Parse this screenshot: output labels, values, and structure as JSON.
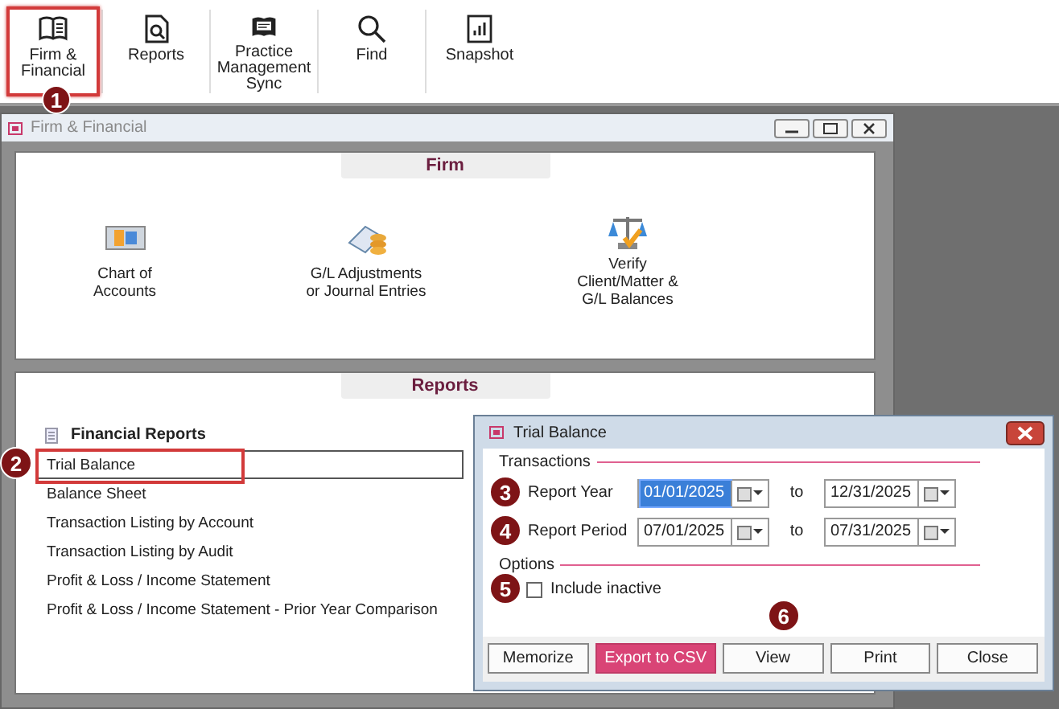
{
  "toolbar": [
    {
      "lines": [
        "Firm &",
        "Financial"
      ],
      "highlighted": true,
      "badge": "1"
    },
    {
      "lines": [
        "Reports"
      ],
      "highlighted": false
    },
    {
      "lines": [
        "Practice",
        "Management",
        "Sync"
      ],
      "highlighted": false
    },
    {
      "lines": [
        "Find"
      ],
      "highlighted": false
    },
    {
      "lines": [
        "Snapshot"
      ],
      "highlighted": false
    }
  ],
  "window": {
    "title": "Firm & Financial",
    "firm_panel": {
      "header": "Firm",
      "items": [
        {
          "lines": [
            "Chart of",
            "Accounts"
          ]
        },
        {
          "lines": [
            "G/L Adjustments",
            "or Journal Entries"
          ]
        },
        {
          "lines": [
            "Verify",
            "Client/Matter &",
            "G/L Balances"
          ]
        }
      ]
    },
    "reports_panel": {
      "header": "Reports",
      "group": "Financial Reports",
      "items": [
        {
          "label": "Trial Balance",
          "selected": true,
          "highlighted": true,
          "badge": "2"
        },
        {
          "label": "Balance Sheet",
          "selected": false,
          "highlighted": false
        },
        {
          "label": "Transaction Listing by Account",
          "selected": false,
          "highlighted": false
        },
        {
          "label": "Transaction Listing by Audit",
          "selected": false,
          "highlighted": false
        },
        {
          "label": "Profit & Loss / Income Statement",
          "selected": false,
          "highlighted": false
        },
        {
          "label": "Profit & Loss / Income Statement - Prior Year Comparison",
          "selected": false,
          "highlighted": false
        }
      ]
    }
  },
  "dialog": {
    "title": "Trial Balance",
    "transactions_legend": "Transactions",
    "rows": [
      {
        "label": "Report Year",
        "from": "01/01/2025",
        "from_text_selected": true,
        "to_word": "to",
        "to": "12/31/2025",
        "badge": "3"
      },
      {
        "label": "Report Period",
        "from": "07/01/2025",
        "from_text_selected": false,
        "to_word": "to",
        "to": "07/31/2025",
        "badge": "4"
      }
    ],
    "options_legend": "Options",
    "options": [
      {
        "label": "Include inactive",
        "checked": false,
        "badge": "5"
      }
    ],
    "buttons": [
      {
        "label": "Memorize",
        "kind": "normal"
      },
      {
        "label": "Export to CSV",
        "kind": "primary"
      },
      {
        "label": "View",
        "kind": "normal",
        "badge": "6"
      },
      {
        "label": "Print",
        "kind": "normal"
      },
      {
        "label": "Close",
        "kind": "normal"
      }
    ]
  }
}
